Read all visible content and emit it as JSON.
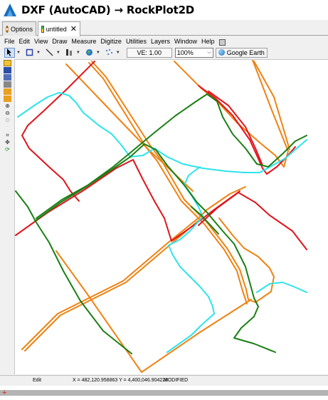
{
  "window": {
    "title": "DXF (AutoCAD) → RockPlot2D"
  },
  "tabs": [
    {
      "label": "Options"
    },
    {
      "label": "untitled",
      "close": "✕"
    }
  ],
  "menu": [
    "File",
    "Edit",
    "View",
    "Draw",
    "Measure",
    "Digitize",
    "Utilities",
    "Layers",
    "Window",
    "Help"
  ],
  "toolbar": {
    "ve_label": "VE: 1.00",
    "zoom_value": "100%",
    "google_earth_label": "Google Earth"
  },
  "status": {
    "mode": "Edit",
    "coords": "X = 482,120.958863  Y = 4,400,046.904228",
    "state": "MODIFIED"
  },
  "colors": {
    "red": "#e0141b",
    "orange": "#ef8212",
    "green": "#1a7f14",
    "cyan": "#2de4ec"
  },
  "icons": [
    "select-arrow-icon",
    "box-select-icon",
    "line-icon",
    "digitize-icon",
    "globe-icon",
    "points-icon",
    "zoom-in-icon",
    "zoom-out-icon",
    "crop-icon",
    "pan-icon",
    "refresh-icon",
    "save-icon",
    "print-icon",
    "close-icon"
  ]
}
